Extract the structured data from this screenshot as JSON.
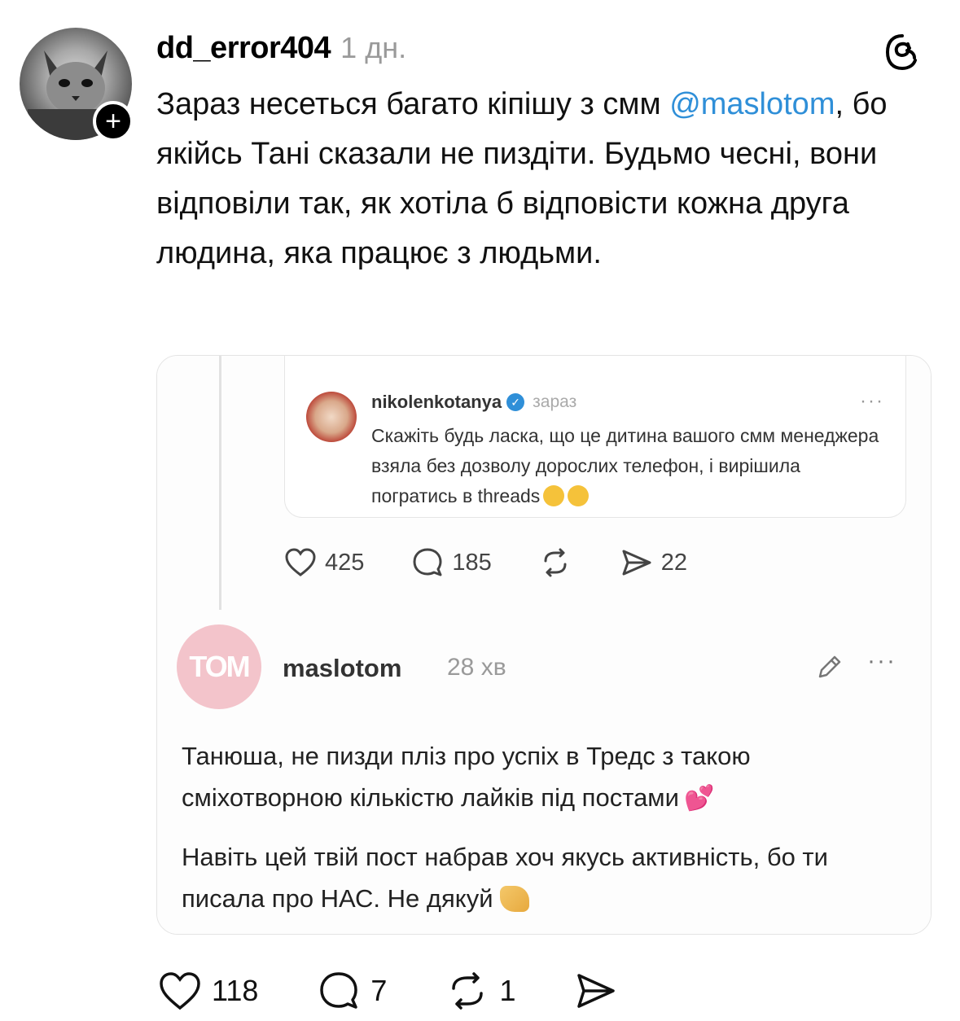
{
  "post": {
    "username": "dd_error404",
    "time": "1 дн.",
    "text_part1": "Зараз несеться багато кіпішу з смм",
    "mention": "@maslotom",
    "text_part2": ", бо якійсь Тані сказали не пиздіти. Будьмо чесні, вони відповіли так, як хотіла б відповісти кожна друга людина, яка працює з людьми.",
    "follow_symbol": "+"
  },
  "embed": {
    "quoted": {
      "username": "nikolenkotanya",
      "time": "зараз",
      "more": "···",
      "text": "Скажіть будь ласка, що це дитина вашого смм менеджера взяла без дозволу дорослих телефон, і вирішила погратись в threads"
    },
    "inner_actions": {
      "likes": "425",
      "replies": "185",
      "shares": "22"
    },
    "reply": {
      "avatar_text": "TOM",
      "username": "maslotom",
      "time": "28 хв",
      "more": "···",
      "text1": "Танюша, не пизди пліз про успіх в Тредс з такою сміхотворною кількістю лайків під постами",
      "text1_emoji": "💕",
      "text2": "Навіть цей твій пост набрав хоч якусь активність, бо ти писала про НАС. Не дякуй"
    }
  },
  "actions": {
    "likes": "118",
    "replies": "7",
    "reposts": "1"
  },
  "icons": [
    "plus-icon",
    "threads-logo-icon",
    "heart-icon",
    "comment-icon",
    "repost-icon",
    "share-icon",
    "verified-icon",
    "edit-icon",
    "more-icon"
  ],
  "colors": {
    "mention": "#2f8fd8",
    "muted": "#9a9a9a",
    "avatar_pink": "#f3c4cb"
  }
}
